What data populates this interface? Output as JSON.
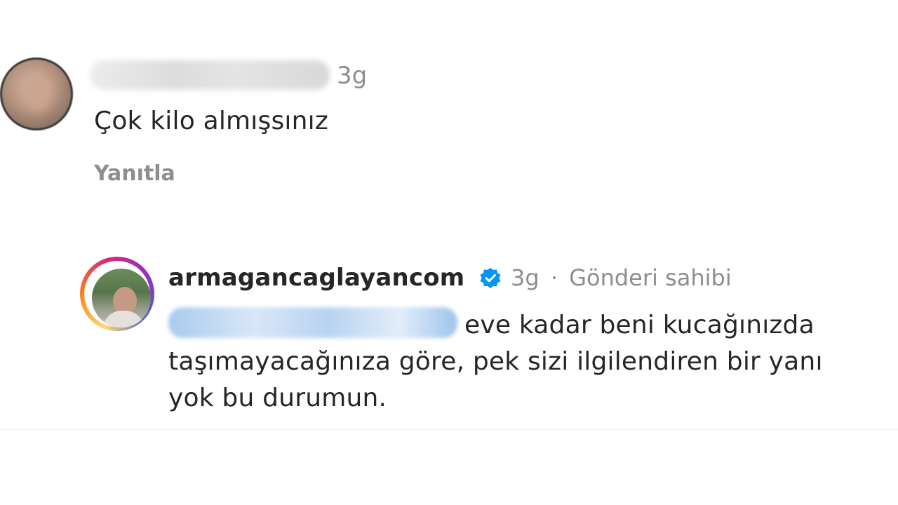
{
  "first_comment": {
    "time": "3g",
    "text": "Çok kilo almışsınız",
    "reply_label": "Yanıtla"
  },
  "reply_comment": {
    "username": "armagancaglayancom",
    "verified_icon": "verified-badge-icon",
    "time": "3g",
    "separator": "·",
    "owner_label": "Gönderi sahibi",
    "text": "eve kadar beni kucağınızda taşımayacağınıza göre, pek sizi ilgilendiren bir yanı yok bu durumun."
  },
  "colors": {
    "text_primary": "#262626",
    "text_secondary": "#8e8e8e",
    "verified_blue": "#0095f6",
    "story_ring": "#d62976"
  }
}
